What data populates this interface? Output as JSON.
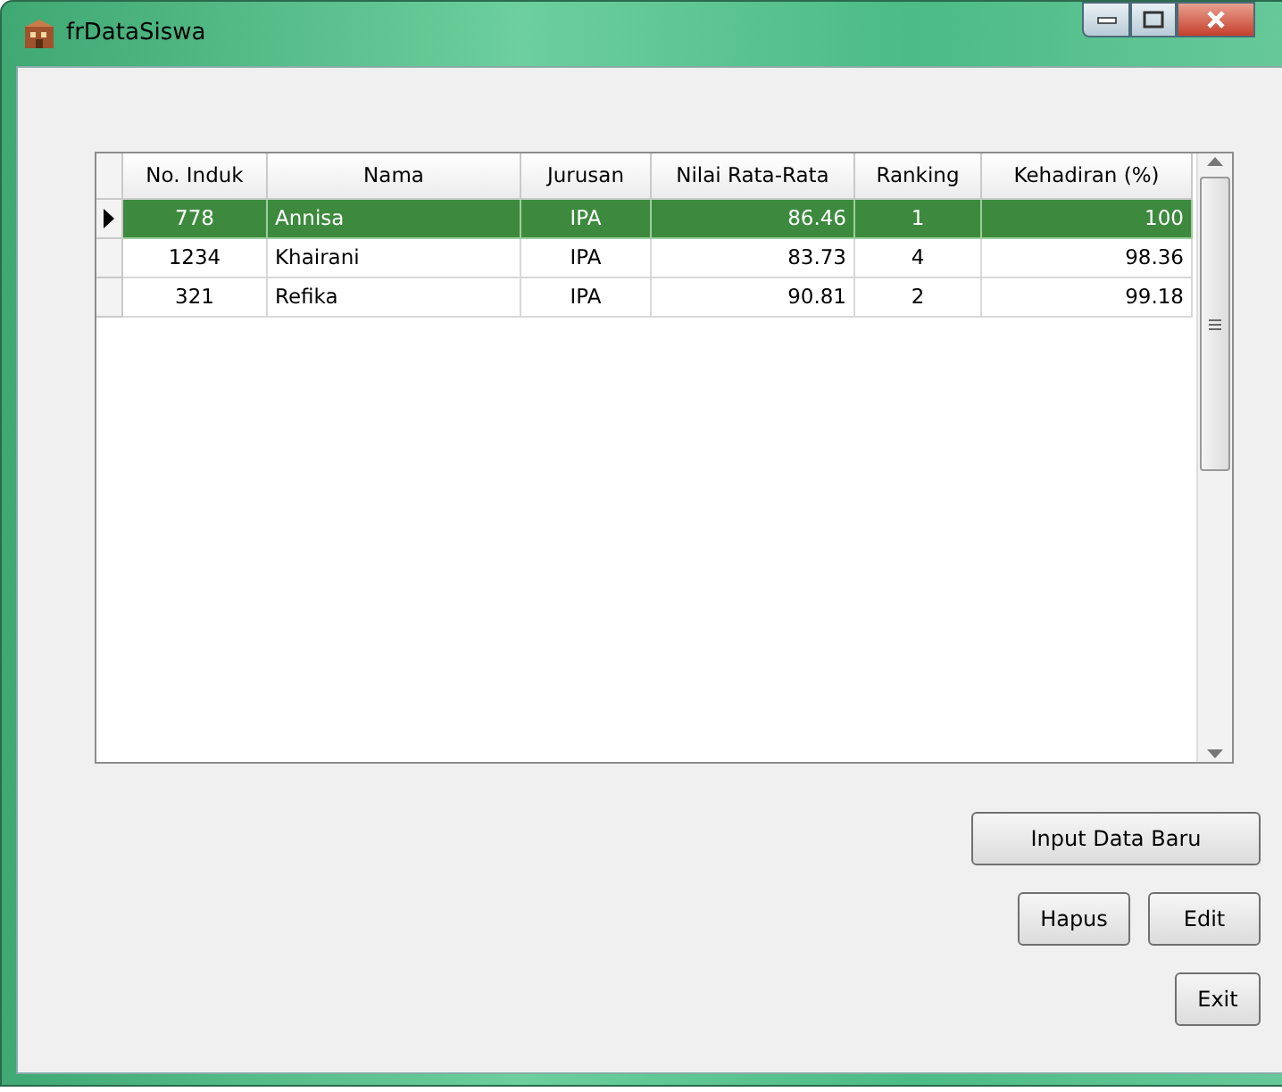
{
  "window": {
    "title": "frDataSiswa"
  },
  "table": {
    "columns": [
      {
        "label": "No. Induk"
      },
      {
        "label": "Nama"
      },
      {
        "label": "Jurusan"
      },
      {
        "label": "Nilai Rata-Rata"
      },
      {
        "label": "Ranking"
      },
      {
        "label": "Kehadiran (%)"
      }
    ],
    "rows": [
      {
        "cells": [
          "778",
          "Annisa",
          "IPA",
          "86.46",
          "1",
          "100"
        ],
        "selected": true
      },
      {
        "cells": [
          "1234",
          "Khairani",
          "IPA",
          "83.73",
          "4",
          "98.36"
        ],
        "selected": false
      },
      {
        "cells": [
          "321",
          "Refika",
          "IPA",
          "90.81",
          "2",
          "99.18"
        ],
        "selected": false
      }
    ]
  },
  "buttons": [
    {
      "label": "Input Data Baru",
      "kind": "wide"
    },
    {
      "label": "Hapus",
      "kind": "pair"
    },
    {
      "label": "Edit",
      "kind": "pair"
    },
    {
      "label": "Exit",
      "kind": "single"
    }
  ]
}
